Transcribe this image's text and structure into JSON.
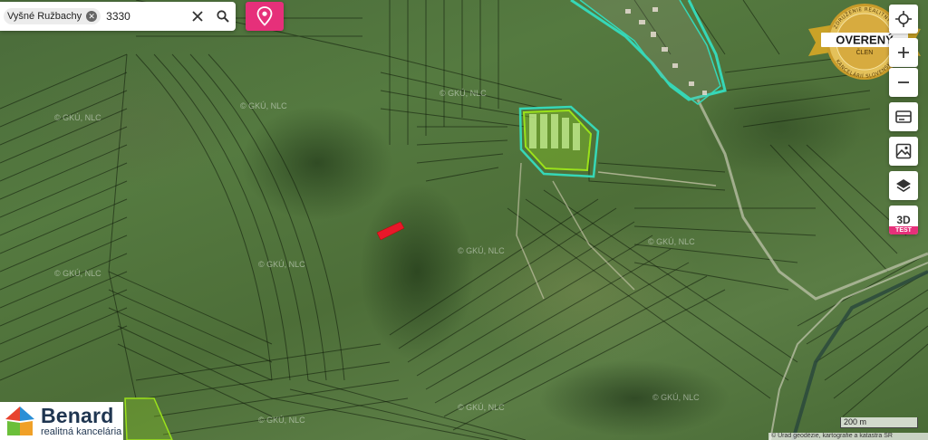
{
  "search": {
    "chip_label": "Vyšné Ružbachy",
    "query": "3330"
  },
  "controls": {
    "three_d_label": "3D",
    "test_badge": "TEST"
  },
  "seal": {
    "main_text": "OVERENÝ",
    "sub_text": "ČLEN",
    "ring_top": "ZDRUŽENIE REALITNÝCH",
    "ring_bottom": "KANCELÁRIÍ SLOVENSKA"
  },
  "logo": {
    "name": "Benard",
    "subtitle": "realitná kancelária"
  },
  "map": {
    "watermark": "© GKÚ, NLC",
    "scale_label": "200 m",
    "attribution": "© Úrad geodézie, kartografie a katastra SR"
  },
  "colors": {
    "accent": "#e6307a",
    "parcel_highlight": "#e8182a",
    "boundary_cyan": "#36d7b7",
    "boundary_lime": "#9be21a"
  }
}
